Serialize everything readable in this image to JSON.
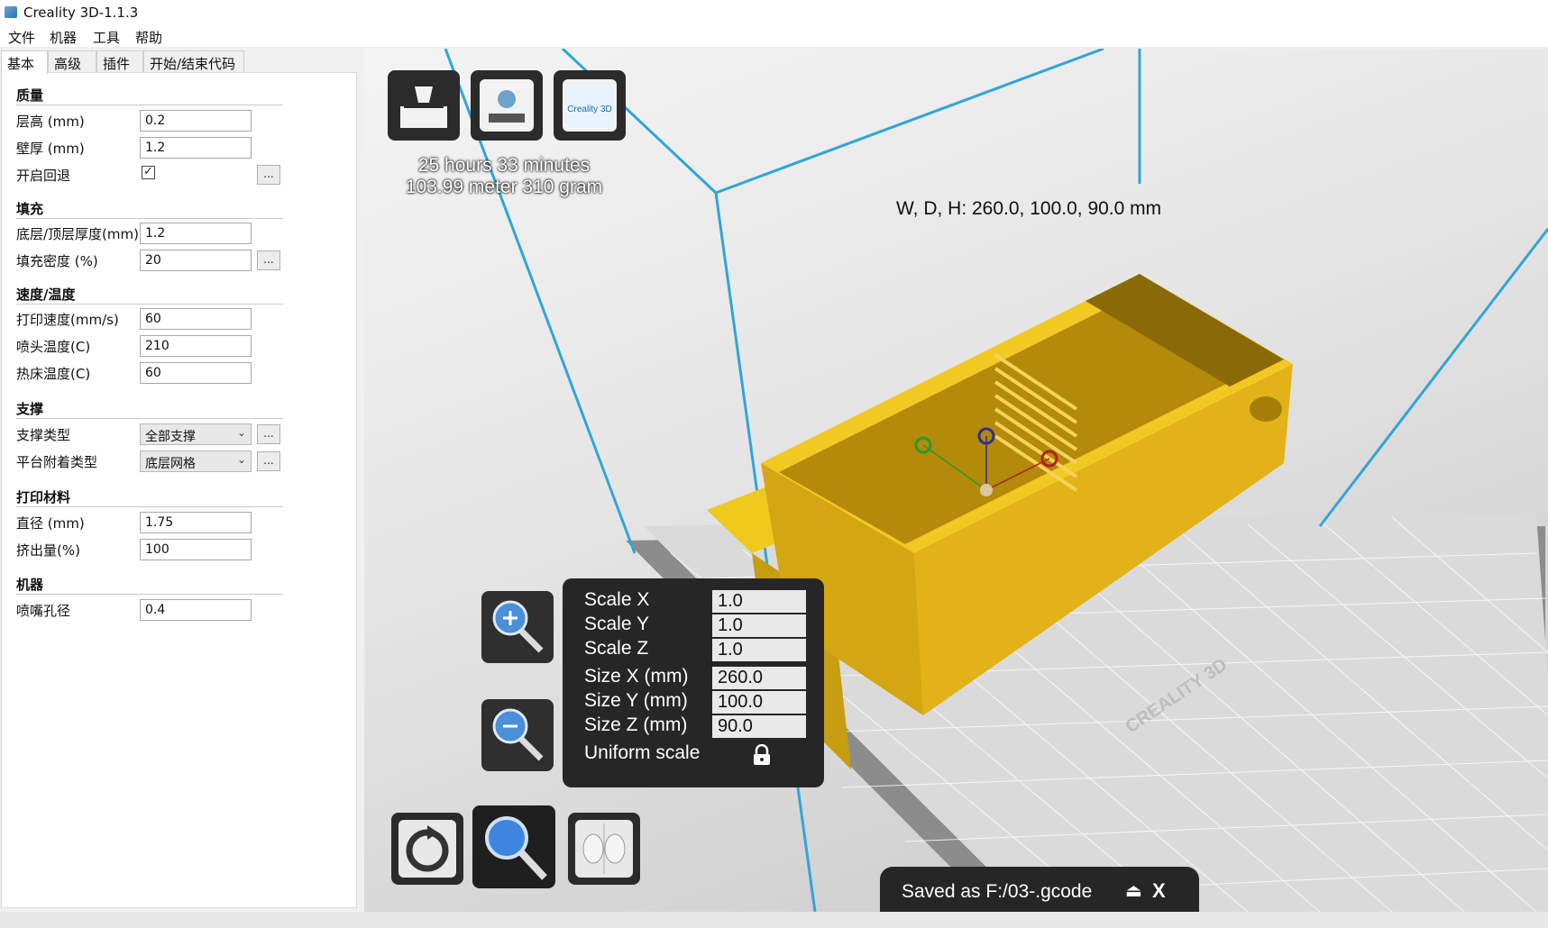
{
  "window": {
    "title": "Creality 3D-1.1.3"
  },
  "menu": [
    "文件",
    "机器",
    "工具",
    "帮助"
  ],
  "tabs": [
    "基本",
    "高级",
    "插件",
    "开始/结束代码"
  ],
  "sections": {
    "quality": {
      "title": "质量",
      "layer_height_label": "层高 (mm)",
      "layer_height": "0.2",
      "shell_label": "壁厚 (mm)",
      "shell": "1.2",
      "retraction_label": "开启回退",
      "retraction_checked": true
    },
    "fill": {
      "title": "填充",
      "bottom_top_label": "底层/顶层厚度(mm)",
      "bottom_top": "1.2",
      "density_label": "填充密度 (%)",
      "density": "20"
    },
    "speed": {
      "title": "速度/温度",
      "print_speed_label": "打印速度(mm/s)",
      "print_speed": "60",
      "nozzle_temp_label": "喷头温度(C)",
      "nozzle_temp": "210",
      "bed_temp_label": "热床温度(C)",
      "bed_temp": "60"
    },
    "support": {
      "title": "支撑",
      "type_label": "支撑类型",
      "type": "全部支撑",
      "adhesion_label": "平台附着类型",
      "adhesion": "底层网格"
    },
    "filament": {
      "title": "打印材料",
      "diameter_label": "直径 (mm)",
      "diameter": "1.75",
      "flow_label": "挤出量(%)",
      "flow": "100"
    },
    "machine": {
      "title": "机器",
      "nozzle_label": "喷嘴孔径",
      "nozzle": "0.4"
    },
    "more_label": "..."
  },
  "viewport": {
    "print_time": "25 hours 33 minutes",
    "print_material": "103.99 meter 310 gram",
    "dimensions": "W, D, H: 260.0, 100.0, 90.0 mm",
    "bed_brand": "CREALITY 3D",
    "logo_text": "Creality 3D",
    "scale": {
      "scale_x_label": "Scale X",
      "scale_x": "1.0",
      "scale_y_label": "Scale Y",
      "scale_y": "1.0",
      "scale_z_label": "Scale Z",
      "scale_z": "1.0",
      "size_x_label": "Size X (mm)",
      "size_x": "260.0",
      "size_y_label": "Size Y (mm)",
      "size_y": "100.0",
      "size_z_label": "Size Z (mm)",
      "size_z": "90.0",
      "uniform_label": "Uniform scale"
    },
    "saved_message": "Saved as F:/03-.gcode",
    "close_label": "X"
  },
  "colors": {
    "model": "#e8b81a",
    "frame": "#2fa6d8",
    "panel": "#262626"
  }
}
